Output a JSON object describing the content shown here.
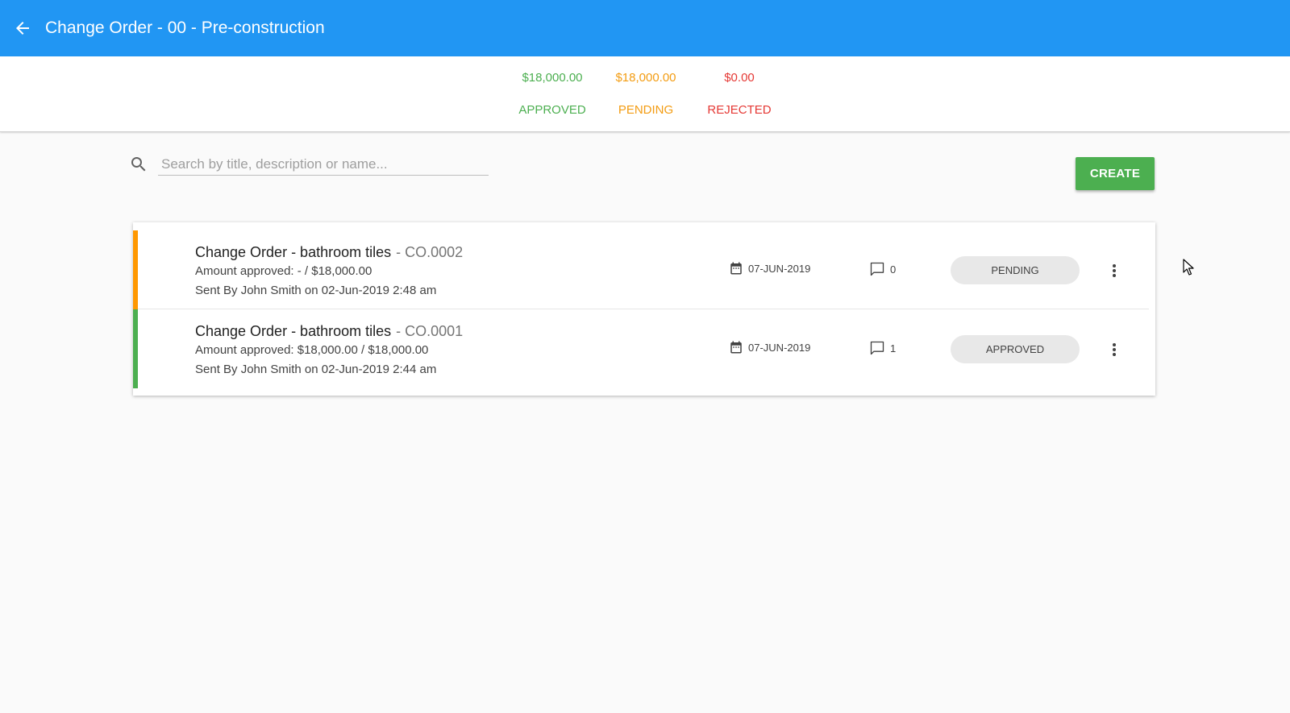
{
  "appbar": {
    "title": "Change Order - 00 - Pre-construction",
    "background": "#2196f3"
  },
  "summary": [
    {
      "amount": "$18,000.00",
      "label": "APPROVED",
      "color": "#4caf50"
    },
    {
      "amount": "$18,000.00",
      "label": "PENDING",
      "color": "#f39c12"
    },
    {
      "amount": "$0.00",
      "label": "REJECTED",
      "color": "#e53935"
    }
  ],
  "search": {
    "placeholder": "Search by title, description or name...",
    "value": ""
  },
  "toolbar": {
    "create_label": "CREATE"
  },
  "change_orders": [
    {
      "title": "Change Order - bathroom tiles",
      "code": "- CO.0002",
      "amount_line": "Amount approved: - / $18,000.00",
      "sent_line": "Sent By John Smith on 02-Jun-2019 2:48 am",
      "date": "07-JUN-2019",
      "comments": "0",
      "status": "PENDING",
      "stripe_color": "#ff9800"
    },
    {
      "title": "Change Order - bathroom tiles",
      "code": "- CO.0001",
      "amount_line": "Amount approved: $18,000.00 / $18,000.00",
      "sent_line": "Sent By John Smith on 02-Jun-2019 2:44 am",
      "date": "07-JUN-2019",
      "comments": "1",
      "status": "APPROVED",
      "stripe_color": "#4caf50"
    }
  ],
  "icons": {
    "back": "arrow-back-icon",
    "search": "search-icon",
    "calendar": "calendar-icon",
    "comment": "comment-icon",
    "more": "more-vert-icon"
  }
}
